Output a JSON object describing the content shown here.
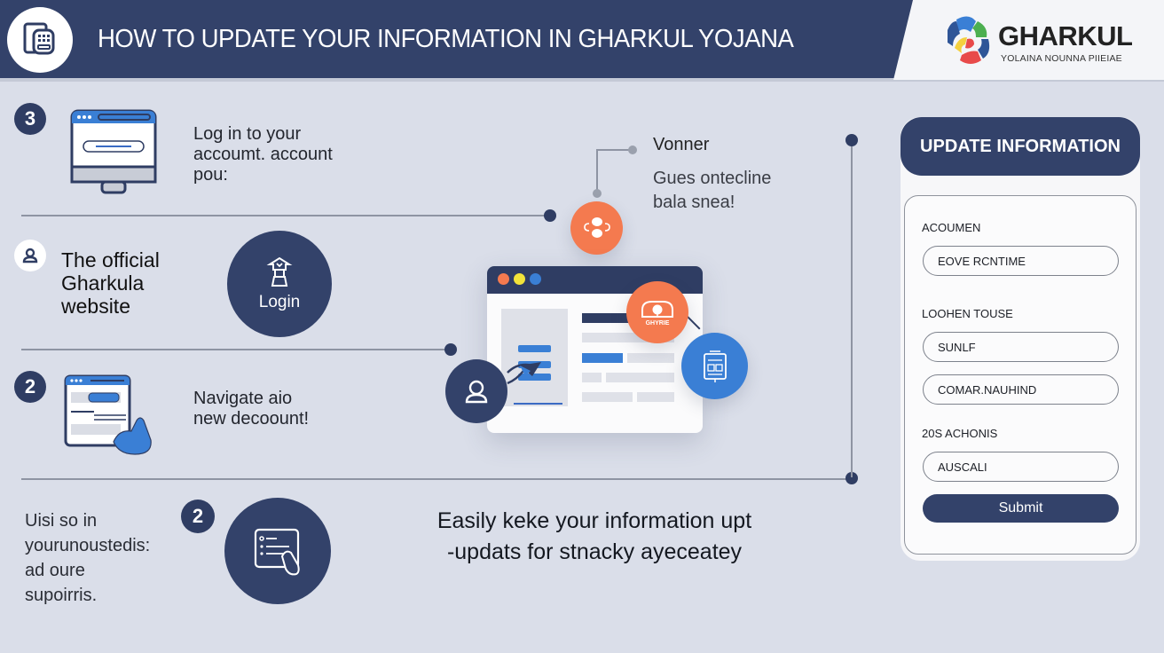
{
  "header": {
    "title": "HOW TO UPDATE YOUR INFORMATION IN GHARKUL YOJANA",
    "icon": "form-document-icon",
    "brand": {
      "name": "GHARKUL",
      "subtitle": "YOLAINA NOUNNA PIIEIAE",
      "logo_icon": "gharkul-logo-icon",
      "logo_colors": [
        "#3a7fd5",
        "#4caf50",
        "#f4d03f",
        "#e84a4a",
        "#2f5597"
      ]
    }
  },
  "steps": [
    {
      "badge": "3",
      "icon": "browser-login-icon",
      "text_lines": [
        "Log in to your",
        "accoumt. account",
        "pou:"
      ]
    },
    {
      "badge_icon": "user-icon",
      "text_lines": [
        "The official",
        "Gharkula",
        "website"
      ],
      "action": {
        "label": "Login",
        "icon": "house-user-icon"
      }
    },
    {
      "badge": "2",
      "icon": "browser-hand-icon",
      "text_lines": [
        "Navigate aio",
        "new decoount!"
      ]
    },
    {
      "badge": "2",
      "icon": "checklist-hand-icon",
      "text_lines": [
        "Uisi so in",
        "yourunoustedis:",
        "ad oure",
        "supoirris."
      ]
    }
  ],
  "illustration": {
    "note_title": "Vonner",
    "note_lines": [
      "Gues ontecline",
      "bala snea!"
    ],
    "orange_badge_label": "GHYRIE",
    "icons": [
      "people-connect-icon",
      "user-icon",
      "cursor-icon",
      "house-icon",
      "document-icon"
    ],
    "traffic_light_colors": [
      "#f47a4f",
      "#f2e33a",
      "#3a7fd5"
    ]
  },
  "tagline": {
    "lines": [
      "Easily keke your information upt",
      "-updats for stnacky ayeceatey"
    ]
  },
  "form": {
    "title": "UPDATE INFORMATION",
    "sections": [
      {
        "label": "ACOUMEN",
        "inputs": [
          "EOVE RCNTIME"
        ]
      },
      {
        "label": "LOOHEN TOUSE",
        "inputs": [
          "SUNLF",
          "COMAR.NAUHIND"
        ]
      },
      {
        "label": "20S ACHONIS",
        "inputs": [
          "AUSCALI"
        ]
      }
    ],
    "submit_label": "Submit"
  },
  "colors": {
    "navy": "#33426a",
    "background": "#dadee9",
    "orange": "#f47a4f",
    "blue": "#3a7fd5"
  }
}
